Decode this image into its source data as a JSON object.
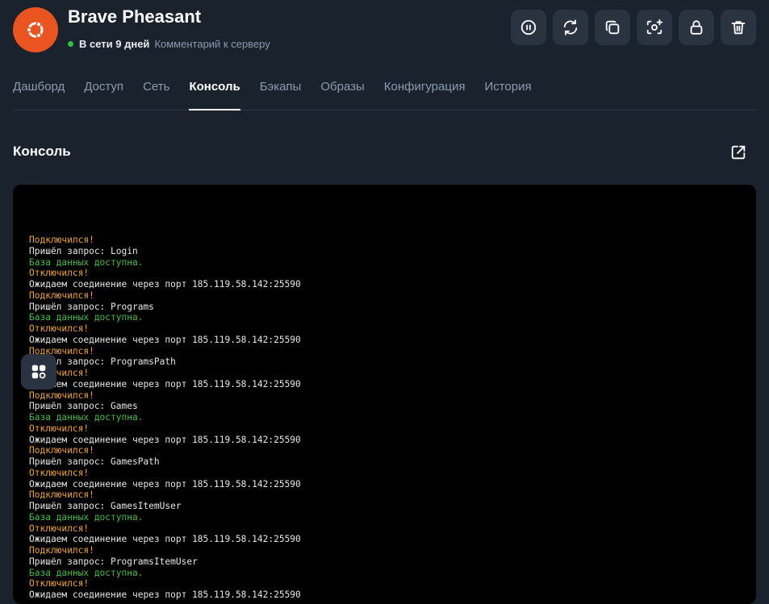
{
  "server": {
    "name": "Brave Pheasant",
    "status_text": "В сети 9 дней",
    "comment_link": "Комментарий к серверу",
    "os_logo_color": "#e95420"
  },
  "status_color": "#31c048",
  "actions": [
    {
      "name": "pause-button",
      "icon": "pause-icon"
    },
    {
      "name": "restart-button",
      "icon": "refresh-icon"
    },
    {
      "name": "clone-button",
      "icon": "copy-icon"
    },
    {
      "name": "snapshot-button",
      "icon": "camera-add-icon"
    },
    {
      "name": "lock-button",
      "icon": "lock-icon"
    },
    {
      "name": "delete-button",
      "icon": "trash-icon"
    }
  ],
  "tabs": [
    "Дашборд",
    "Доступ",
    "Сеть",
    "Консоль",
    "Бэкапы",
    "Образы",
    "Конфигурация",
    "История"
  ],
  "active_tab": "Консоль",
  "section": {
    "title": "Консоль"
  },
  "console_lines": [
    {
      "t": "Подключился!",
      "c": "orange"
    },
    {
      "t": "Пришёл запрос: Login",
      "c": "white"
    },
    {
      "t": "База данных доступна.",
      "c": "green"
    },
    {
      "t": "Отключился!",
      "c": "orange"
    },
    {
      "t": "Ожидаем соединение через порт 185.119.58.142:25590",
      "c": "white"
    },
    {
      "t": "Подключился!",
      "c": "orange"
    },
    {
      "t": "Пришёл запрос: Programs",
      "c": "white"
    },
    {
      "t": "База данных доступна.",
      "c": "green"
    },
    {
      "t": "Отключился!",
      "c": "orange"
    },
    {
      "t": "Ожидаем соединение через порт 185.119.58.142:25590",
      "c": "white"
    },
    {
      "t": "Подключился!",
      "c": "orange"
    },
    {
      "t": "Пришёл запрос: ProgramsPath",
      "c": "white"
    },
    {
      "t": "Отключился!",
      "c": "orange"
    },
    {
      "t": "Ожидаем соединение через порт 185.119.58.142:25590",
      "c": "white"
    },
    {
      "t": "Подключился!",
      "c": "orange"
    },
    {
      "t": "Пришёл запрос: Games",
      "c": "white"
    },
    {
      "t": "База данных доступна.",
      "c": "green"
    },
    {
      "t": "Отключился!",
      "c": "orange"
    },
    {
      "t": "Ожидаем соединение через порт 185.119.58.142:25590",
      "c": "white"
    },
    {
      "t": "Подключился!",
      "c": "orange"
    },
    {
      "t": "Пришёл запрос: GamesPath",
      "c": "white"
    },
    {
      "t": "Отключился!",
      "c": "orange"
    },
    {
      "t": "Ожидаем соединение через порт 185.119.58.142:25590",
      "c": "white"
    },
    {
      "t": "Подключился!",
      "c": "orange"
    },
    {
      "t": "Пришёл запрос: GamesItemUser",
      "c": "white"
    },
    {
      "t": "База данных доступна.",
      "c": "green"
    },
    {
      "t": "Отключился!",
      "c": "orange"
    },
    {
      "t": "Ожидаем соединение через порт 185.119.58.142:25590",
      "c": "white"
    },
    {
      "t": "Подключился!",
      "c": "orange"
    },
    {
      "t": "Пришёл запрос: ProgramsItemUser",
      "c": "white"
    },
    {
      "t": "База данных доступна.",
      "c": "green"
    },
    {
      "t": "Отключился!",
      "c": "orange"
    },
    {
      "t": "Ожидаем соединение через порт 185.119.58.142:25590",
      "c": "white"
    }
  ]
}
